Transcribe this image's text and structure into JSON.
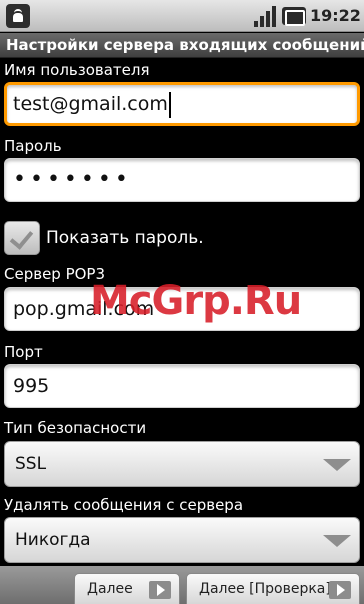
{
  "status_bar": {
    "time": "19:22",
    "icons": [
      "android-notification-icon",
      "signal-icon",
      "battery-charging-icon"
    ]
  },
  "title": "Настройки сервера входящих сообщений",
  "form": {
    "username": {
      "label": "Имя пользователя",
      "value": "test@gmail.com"
    },
    "password": {
      "label": "Пароль",
      "value": "•••••••"
    },
    "show_password": {
      "label": "Показать пароль.",
      "checked": true
    },
    "pop3_server": {
      "label": "Сервер POP3",
      "value": "pop.gmail.com"
    },
    "port": {
      "label": "Порт",
      "value": "995"
    },
    "security_type": {
      "label": "Тип безопасности",
      "value": "SSL"
    },
    "delete_messages": {
      "label": "Удалять сообщения с сервера",
      "value": "Никогда"
    }
  },
  "buttons": {
    "next": "Далее",
    "next_verify": "Далее [Проверка]"
  },
  "watermark": "McGrp.Ru",
  "colors": {
    "focus": "#ff9a00",
    "watermark": "#d71e28"
  }
}
